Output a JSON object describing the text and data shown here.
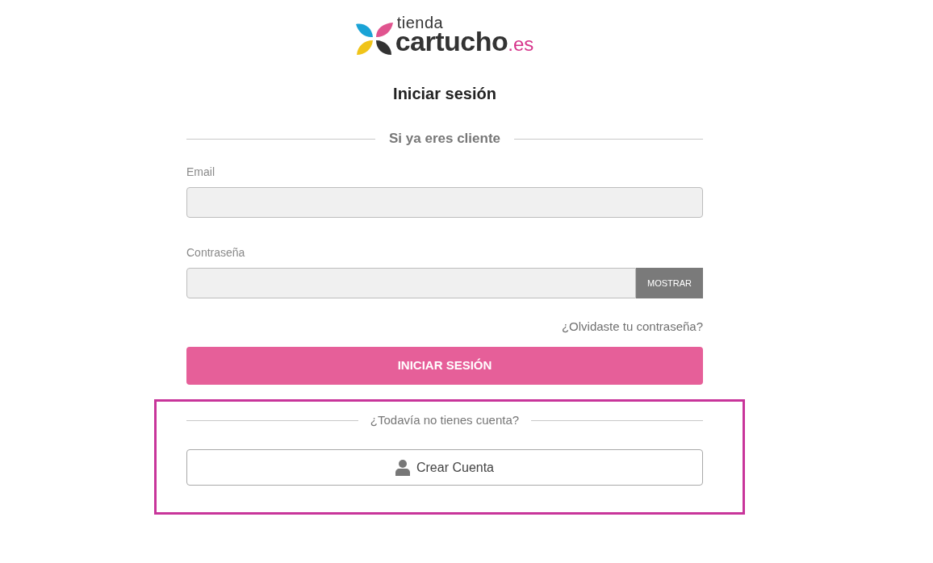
{
  "logo": {
    "line_1": "tienda",
    "line_2": "cartucho",
    "suffix": ".es"
  },
  "title": "Iniciar sesión",
  "login": {
    "heading": "Si ya eres cliente",
    "fields": [
      {
        "kind": "text",
        "label": "Email"
      },
      {
        "kind": "password",
        "label": "Contraseña",
        "toggle": "MOSTRAR"
      }
    ],
    "forgot_link": "¿Olvidaste tu contraseña?",
    "submit": "INICIAR SESIÓN"
  },
  "signup": {
    "highlighted": true,
    "heading": "¿Todavía no tienes cuenta?",
    "button": "Crear Cuenta"
  }
}
